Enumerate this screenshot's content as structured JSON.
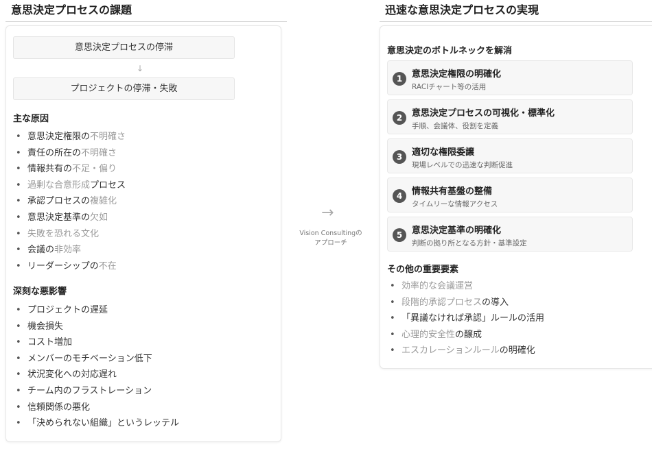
{
  "left": {
    "heading": "意思決定プロセスの課題",
    "flow": {
      "box1": "意思決定プロセスの停滞",
      "arrow": "↓",
      "box2": "プロジェクトの停滞・失敗"
    },
    "causes_heading": "主な原因",
    "causes": [
      [
        {
          "t": "意思決定権限の"
        },
        {
          "t": "不明確さ",
          "hl": true
        }
      ],
      [
        {
          "t": "責任の所在の"
        },
        {
          "t": "不明確さ",
          "hl": true
        }
      ],
      [
        {
          "t": "情報共有の"
        },
        {
          "t": "不足・偏り",
          "hl": true
        }
      ],
      [
        {
          "t": "過剰な合意形成",
          "hl": true
        },
        {
          "t": "プロセス"
        }
      ],
      [
        {
          "t": "承認プロセスの"
        },
        {
          "t": "複雑化",
          "hl": true
        }
      ],
      [
        {
          "t": "意思決定基準の"
        },
        {
          "t": "欠如",
          "hl": true
        }
      ],
      [
        {
          "t": "失敗を恐れる文化",
          "hl": true
        }
      ],
      [
        {
          "t": "会議の"
        },
        {
          "t": "非効率",
          "hl": true
        }
      ],
      [
        {
          "t": "リーダーシップの"
        },
        {
          "t": "不在",
          "hl": true
        }
      ]
    ],
    "impacts_heading": "深刻な悪影響",
    "impacts": [
      "プロジェクトの遅延",
      "機会損失",
      "コスト増加",
      "メンバーのモチベーション低下",
      "状況変化への対応遅れ",
      "チーム内のフラストレーション",
      "信頼関係の悪化",
      "「決められない組織」というレッテル"
    ]
  },
  "center": {
    "arrow": "→",
    "caption_line1": "Vision Consultingの",
    "caption_line2": "アプローチ"
  },
  "right": {
    "heading": "迅速な意思決定プロセスの実現",
    "solutions_heading": "意思決定のボトルネックを解消",
    "steps": [
      {
        "num": "1",
        "title": "意思決定権限の明確化",
        "desc": "RACIチャート等の活用"
      },
      {
        "num": "2",
        "title": "意思決定プロセスの可視化・標準化",
        "desc": "手順、会議体、役割を定義"
      },
      {
        "num": "3",
        "title": "適切な権限委譲",
        "desc": "現場レベルでの迅速な判断促進"
      },
      {
        "num": "4",
        "title": "情報共有基盤の整備",
        "desc": "タイムリーな情報アクセス"
      },
      {
        "num": "5",
        "title": "意思決定基準の明確化",
        "desc": "判断の拠り所となる方針・基準設定"
      }
    ],
    "others_heading": "その他の重要要素",
    "others": [
      [
        {
          "t": "効率的な会議運営",
          "hl": true
        }
      ],
      [
        {
          "t": "段階的承認プロセス",
          "hl": true
        },
        {
          "t": "の導入"
        }
      ],
      [
        {
          "t": "「異議なければ承認」ルール"
        },
        {
          "t": "の活用"
        }
      ],
      [
        {
          "t": "心理的安全性",
          "hl": true
        },
        {
          "t": "の醸成"
        }
      ],
      [
        {
          "t": "エスカレーションルール",
          "hl": true
        },
        {
          "t": "の明確化"
        }
      ]
    ]
  }
}
